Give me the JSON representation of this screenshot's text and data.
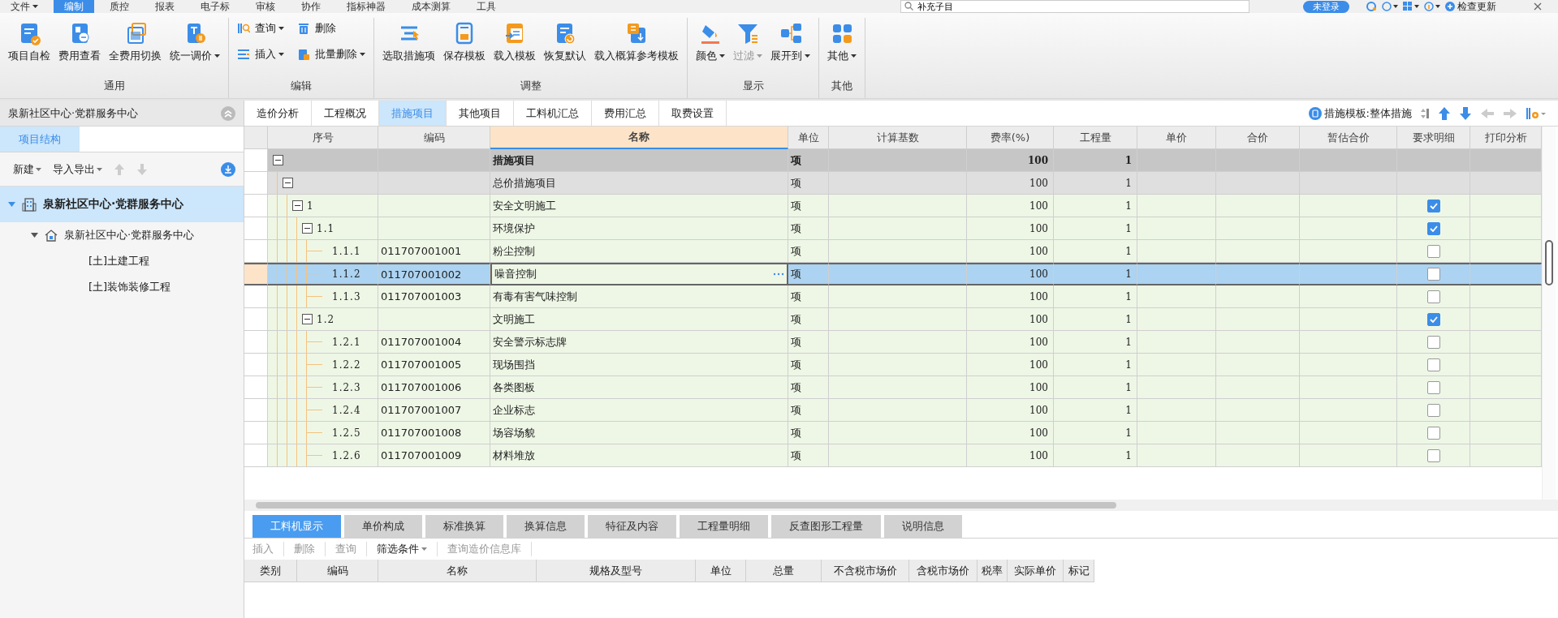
{
  "menu": [
    {
      "label": "文件",
      "dropdown": true,
      "selected": false
    },
    {
      "label": "编制",
      "dropdown": false,
      "selected": true
    },
    {
      "label": "质控",
      "dropdown": false,
      "selected": false
    },
    {
      "label": "报表",
      "dropdown": false,
      "selected": false
    },
    {
      "label": "电子标",
      "dropdown": false,
      "selected": false
    },
    {
      "label": "审核",
      "dropdown": false,
      "selected": false
    },
    {
      "label": "协作",
      "dropdown": false,
      "selected": false
    },
    {
      "label": "指标神器",
      "dropdown": false,
      "selected": false
    },
    {
      "label": "成本测算",
      "dropdown": false,
      "selected": false
    },
    {
      "label": "工具",
      "dropdown": false,
      "selected": false
    }
  ],
  "search": {
    "value": "补充子目"
  },
  "top_right": {
    "login": "未登录",
    "update": "检查更新"
  },
  "ribbon": [
    {
      "title": "通用",
      "kind": "large",
      "buttons": [
        {
          "label": "项目自检",
          "dropdown": false,
          "disabled": false
        },
        {
          "label": "费用查看",
          "dropdown": false,
          "disabled": false
        },
        {
          "label": "全费用切换",
          "dropdown": false,
          "disabled": false
        },
        {
          "label": "统一调价",
          "dropdown": true,
          "disabled": false
        }
      ]
    },
    {
      "title": "编辑",
      "kind": "small",
      "buttons": [
        {
          "label": "查询",
          "dropdown": true,
          "disabled": false
        },
        {
          "label": "删除",
          "dropdown": false,
          "disabled": false
        },
        {
          "label": "插入",
          "dropdown": true,
          "disabled": false
        },
        {
          "label": "批量删除",
          "dropdown": true,
          "disabled": false
        }
      ]
    },
    {
      "title": "调整",
      "kind": "large",
      "buttons": [
        {
          "label": "选取措施项",
          "dropdown": false,
          "disabled": false
        },
        {
          "label": "保存模板",
          "dropdown": false,
          "disabled": false
        },
        {
          "label": "载入模板",
          "dropdown": false,
          "disabled": false
        },
        {
          "label": "恢复默认",
          "dropdown": false,
          "disabled": false
        },
        {
          "label": "载入概算参考模板",
          "dropdown": false,
          "disabled": false
        }
      ]
    },
    {
      "title": "显示",
      "kind": "large",
      "buttons": [
        {
          "label": "颜色",
          "dropdown": true,
          "disabled": false
        },
        {
          "label": "过滤",
          "dropdown": true,
          "disabled": true
        },
        {
          "label": "展开到",
          "dropdown": true,
          "disabled": false
        }
      ]
    },
    {
      "title": "其他",
      "kind": "large",
      "buttons": [
        {
          "label": "其他",
          "dropdown": true,
          "disabled": false
        }
      ]
    }
  ],
  "left_panel": {
    "title": "泉新社区中心·党群服务中心",
    "tabs": [
      {
        "label": "项目结构",
        "selected": true
      }
    ],
    "toolbar": [
      {
        "label": "新建",
        "dropdown": true
      },
      {
        "label": "导入导出",
        "dropdown": true
      }
    ],
    "tree": [
      {
        "label": "泉新社区中心·党群服务中心",
        "kind": "project",
        "selected": true,
        "expanded": true,
        "children": [
          {
            "label": "泉新社区中心·党群服务中心",
            "kind": "single",
            "selected": false,
            "expanded": true,
            "children": [
              {
                "label": "[土]土建工程",
                "kind": "unit",
                "selected": false
              },
              {
                "label": "[土]装饰装修工程",
                "kind": "unit",
                "selected": false
              }
            ]
          }
        ]
      }
    ]
  },
  "tabs": [
    {
      "label": "造价分析",
      "selected": false
    },
    {
      "label": "工程概况",
      "selected": false
    },
    {
      "label": "措施项目",
      "selected": true
    },
    {
      "label": "其他项目",
      "selected": false
    },
    {
      "label": "工料机汇总",
      "selected": false
    },
    {
      "label": "费用汇总",
      "selected": false
    },
    {
      "label": "取费设置",
      "selected": false
    }
  ],
  "template": {
    "label": "措施模板:整体措施"
  },
  "table": {
    "columns": [
      {
        "label": "序号",
        "selected": false
      },
      {
        "label": "编码",
        "selected": false
      },
      {
        "label": "名称",
        "selected": true
      },
      {
        "label": "单位",
        "selected": false
      },
      {
        "label": "计算基数",
        "selected": false
      },
      {
        "label": "费率(%)",
        "selected": false
      },
      {
        "label": "工程量",
        "selected": false
      },
      {
        "label": "单价",
        "selected": false
      },
      {
        "label": "合价",
        "selected": false
      },
      {
        "label": "暂估合价",
        "selected": false
      },
      {
        "label": "要求明细",
        "selected": false
      },
      {
        "label": "打印分析",
        "selected": false
      }
    ],
    "rows": [
      {
        "name": "措施项目",
        "unit": "项",
        "rate": "100",
        "qty": "1",
        "selected": false,
        "expanded": true,
        "children": [
          {
            "name": "总价措施项目",
            "unit": "项",
            "rate": "100",
            "qty": "1",
            "selected": false,
            "expanded": true,
            "children": [
              {
                "seq": "1",
                "name": "安全文明施工",
                "unit": "项",
                "rate": "100",
                "qty": "1",
                "detail": true,
                "selected": false,
                "expanded": true,
                "children": [
                  {
                    "seq": "1.1",
                    "name": "环境保护",
                    "unit": "项",
                    "rate": "100",
                    "qty": "1",
                    "detail": true,
                    "selected": false,
                    "expanded": true,
                    "children": [
                      {
                        "seq": "1.1.1",
                        "code": "011707001001",
                        "name": "粉尘控制",
                        "unit": "项",
                        "rate": "100",
                        "qty": "1",
                        "detail": false,
                        "selected": false
                      },
                      {
                        "seq": "1.1.2",
                        "code": "011707001002",
                        "name": "噪音控制",
                        "unit": "项",
                        "rate": "100",
                        "qty": "1",
                        "detail": false,
                        "selected": true
                      },
                      {
                        "seq": "1.1.3",
                        "code": "011707001003",
                        "name": "有毒有害气味控制",
                        "unit": "项",
                        "rate": "100",
                        "qty": "1",
                        "detail": false,
                        "selected": false
                      }
                    ]
                  },
                  {
                    "seq": "1.2",
                    "name": "文明施工",
                    "unit": "项",
                    "rate": "100",
                    "qty": "1",
                    "detail": true,
                    "selected": false,
                    "expanded": true,
                    "children": [
                      {
                        "seq": "1.2.1",
                        "code": "011707001004",
                        "name": "安全警示标志牌",
                        "unit": "项",
                        "rate": "100",
                        "qty": "1",
                        "detail": false,
                        "selected": false
                      },
                      {
                        "seq": "1.2.2",
                        "code": "011707001005",
                        "name": "现场围挡",
                        "unit": "项",
                        "rate": "100",
                        "qty": "1",
                        "detail": false,
                        "selected": false
                      },
                      {
                        "seq": "1.2.3",
                        "code": "011707001006",
                        "name": "各类图板",
                        "unit": "项",
                        "rate": "100",
                        "qty": "1",
                        "detail": false,
                        "selected": false
                      },
                      {
                        "seq": "1.2.4",
                        "code": "011707001007",
                        "name": "企业标志",
                        "unit": "项",
                        "rate": "100",
                        "qty": "1",
                        "detail": false,
                        "selected": false
                      },
                      {
                        "seq": "1.2.5",
                        "code": "011707001008",
                        "name": "场容场貌",
                        "unit": "项",
                        "rate": "100",
                        "qty": "1",
                        "detail": false,
                        "selected": false
                      },
                      {
                        "seq": "1.2.6",
                        "code": "011707001009",
                        "name": "材料堆放",
                        "unit": "项",
                        "rate": "100",
                        "qty": "1",
                        "detail": false,
                        "selected": false
                      }
                    ]
                  }
                ]
              }
            ]
          }
        ]
      }
    ]
  },
  "detail_tabs": [
    {
      "label": "工料机显示",
      "selected": true
    },
    {
      "label": "单价构成",
      "selected": false
    },
    {
      "label": "标准换算",
      "selected": false
    },
    {
      "label": "换算信息",
      "selected": false
    },
    {
      "label": "特征及内容",
      "selected": false
    },
    {
      "label": "工程量明细",
      "selected": false
    },
    {
      "label": "反查图形工程量",
      "selected": false
    },
    {
      "label": "说明信息",
      "selected": false
    }
  ],
  "detail_toolbar": [
    {
      "label": "插入",
      "dropdown": false,
      "disabled": true
    },
    {
      "label": "删除",
      "dropdown": false,
      "disabled": true
    },
    {
      "label": "查询",
      "dropdown": false,
      "disabled": true
    },
    {
      "label": "筛选条件",
      "dropdown": true,
      "disabled": false
    },
    {
      "label": "查询造价信息库",
      "dropdown": false,
      "disabled": true
    }
  ],
  "detail_columns": [
    "类别",
    "编码",
    "名称",
    "规格及型号",
    "单位",
    "总量",
    "不含税市场价",
    "含税市场价",
    "税率",
    "实际单价",
    "标记"
  ]
}
